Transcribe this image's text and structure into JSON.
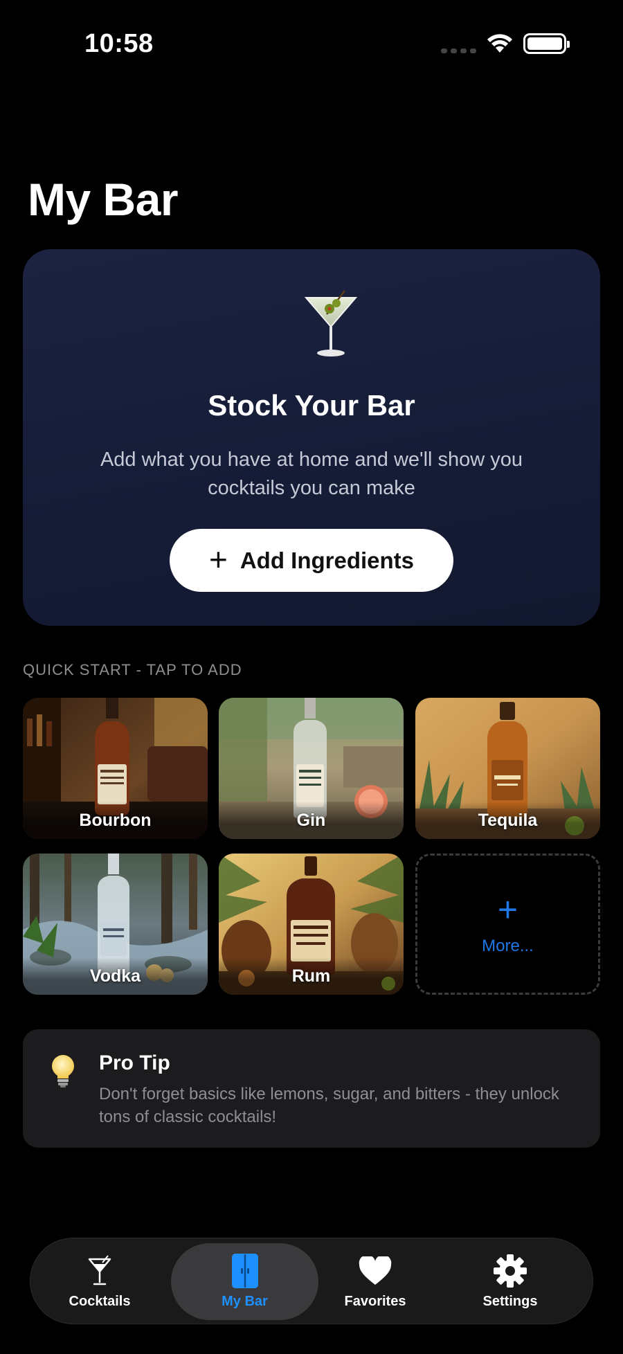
{
  "status": {
    "time": "10:58"
  },
  "title": "My Bar",
  "hero": {
    "title": "Stock Your Bar",
    "subtitle": "Add what you have at home and we'll show you cocktails you can make",
    "button_label": "Add Ingredients"
  },
  "quick_start": {
    "label": "QUICK START - TAP TO ADD",
    "items": [
      {
        "label": "Bourbon"
      },
      {
        "label": "Gin"
      },
      {
        "label": "Tequila"
      },
      {
        "label": "Vodka"
      },
      {
        "label": "Rum"
      }
    ],
    "more_label": "More..."
  },
  "tip": {
    "title": "Pro Tip",
    "text": "Don't forget basics like lemons, sugar, and bitters - they unlock tons of classic cocktails!"
  },
  "tabs": [
    {
      "label": "Cocktails",
      "icon": "martini-glass-icon",
      "active": false
    },
    {
      "label": "My Bar",
      "icon": "cabinet-icon",
      "active": true
    },
    {
      "label": "Favorites",
      "icon": "heart-icon",
      "active": false
    },
    {
      "label": "Settings",
      "icon": "gear-icon",
      "active": false
    }
  ],
  "colors": {
    "accent": "#1e90ff",
    "hero_bg": "#1a2140",
    "card_bg": "#1c1c1e"
  }
}
